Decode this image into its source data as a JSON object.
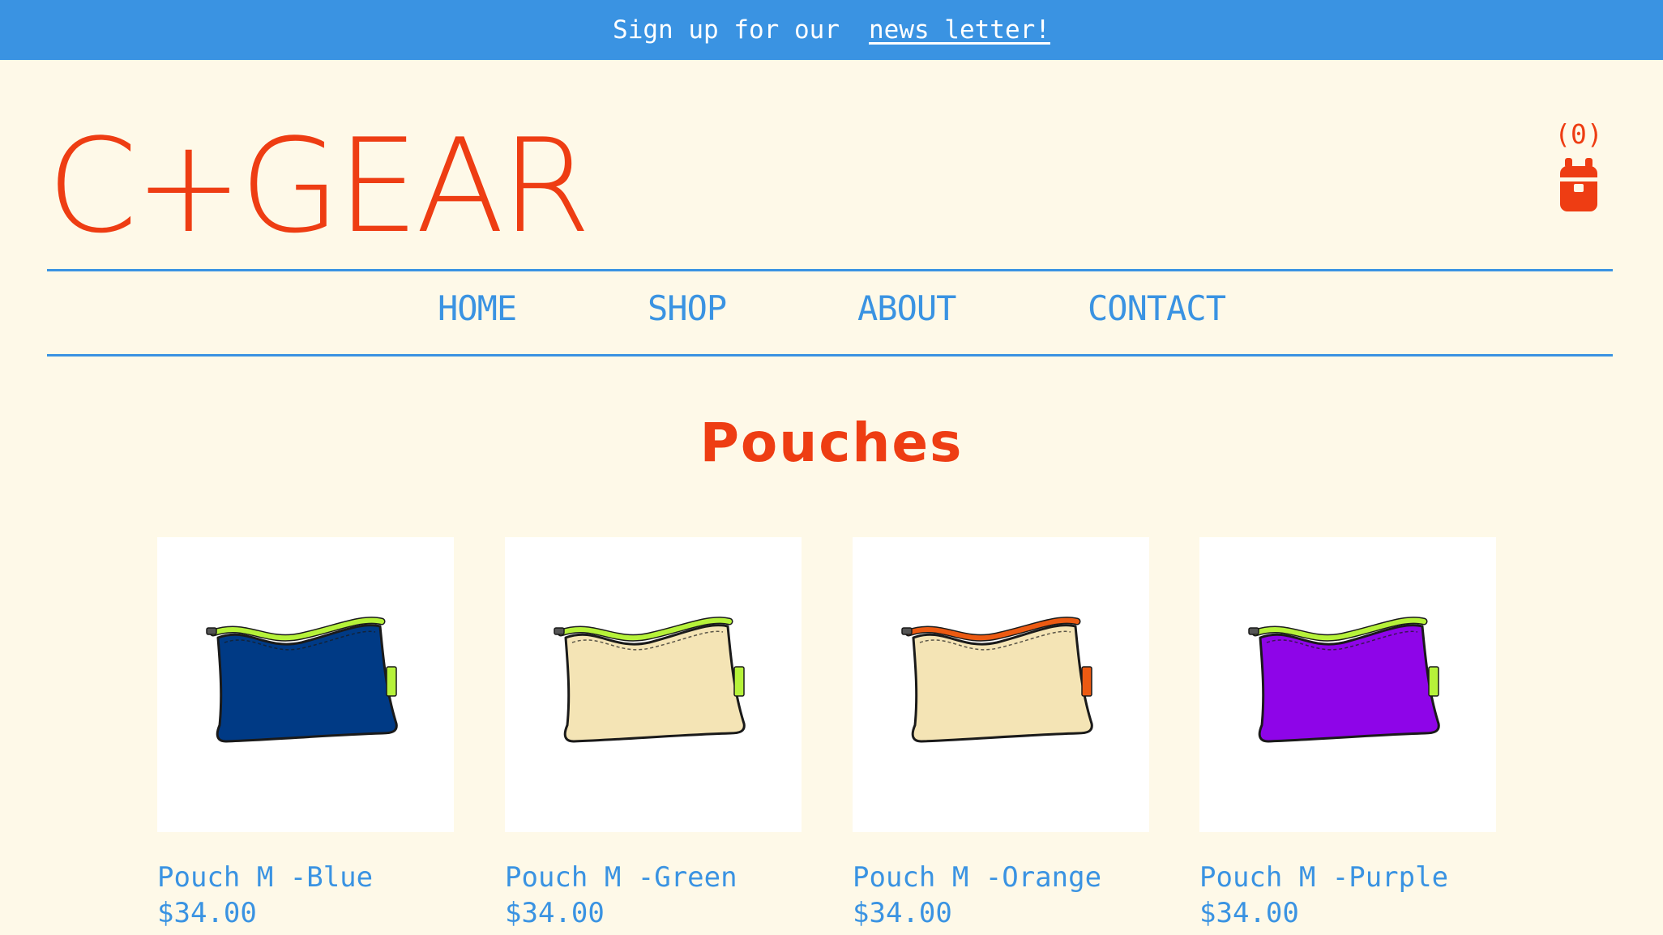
{
  "announcement": {
    "text": "Sign up for our",
    "link_text": "news letter!"
  },
  "header": {
    "logo_text": "C+GEAR",
    "cart_count": "(0)",
    "cart_icon": "backpack-icon"
  },
  "nav": {
    "items": [
      {
        "label": "HOME"
      },
      {
        "label": "SHOP"
      },
      {
        "label": "ABOUT"
      },
      {
        "label": "CONTACT"
      }
    ]
  },
  "page": {
    "title": "Pouches"
  },
  "products": [
    {
      "name": "Pouch M -Blue",
      "price": "$34.00",
      "body_color": "#003a85",
      "zip_color": "#b6f23a",
      "tab_color": "#b6f23a"
    },
    {
      "name": "Pouch M -Green",
      "price": "$34.00",
      "body_color": "#f4e4b5",
      "zip_color": "#b6f23a",
      "tab_color": "#b6f23a"
    },
    {
      "name": "Pouch M -Orange",
      "price": "$34.00",
      "body_color": "#f4e4b5",
      "zip_color": "#ec5a12",
      "tab_color": "#ec5a12"
    },
    {
      "name": "Pouch M -Purple",
      "price": "$34.00",
      "body_color": "#8e05e8",
      "zip_color": "#b6f23a",
      "tab_color": "#b6f23a"
    }
  ],
  "colors": {
    "brand": "#ee3d13",
    "accent": "#3a93e2",
    "background": "#fef9e8"
  }
}
